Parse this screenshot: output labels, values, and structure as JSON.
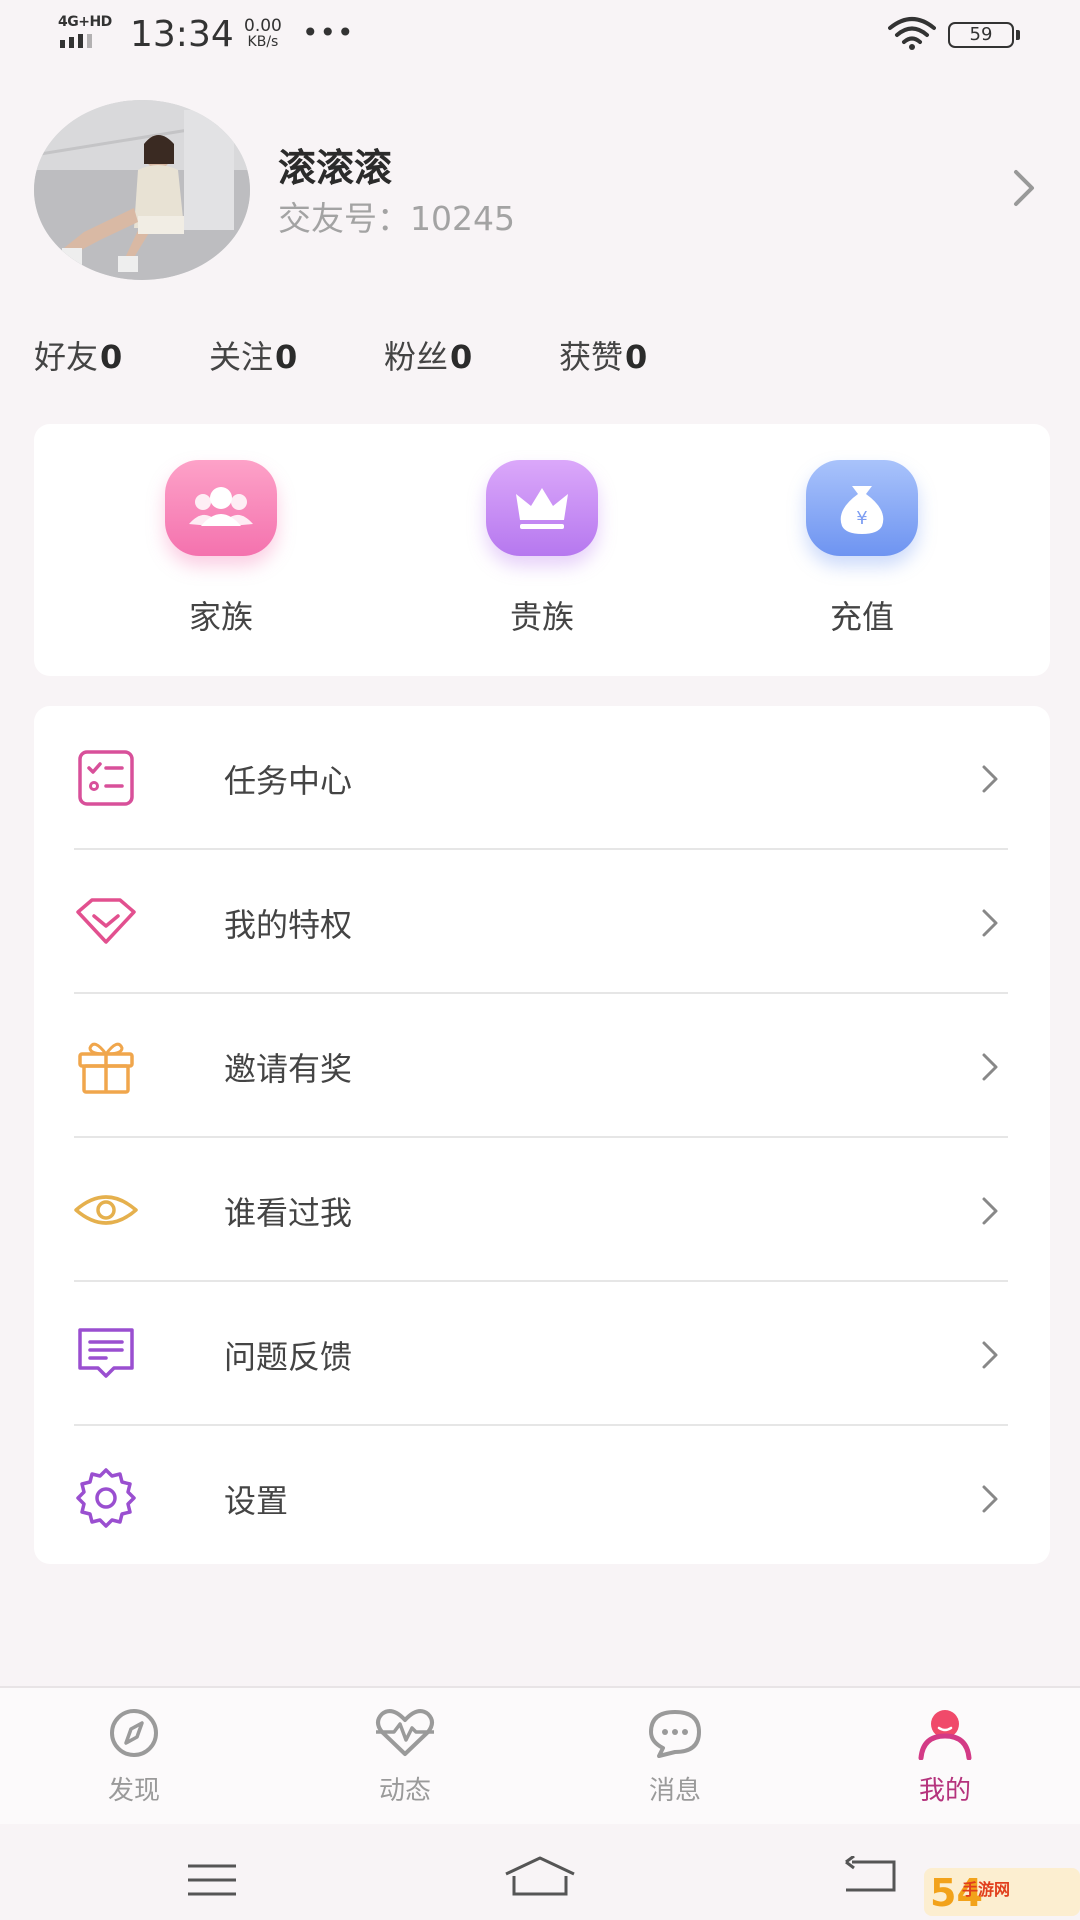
{
  "status_bar": {
    "network": "4G+HD",
    "time": "13:34",
    "speed_value": "0.00",
    "speed_unit": "KB/s",
    "more": "•••",
    "battery": "59"
  },
  "profile": {
    "name": "滚滚滚",
    "id_label": "交友号：",
    "id_value": "10245"
  },
  "stats": [
    {
      "label": "好友",
      "value": "0"
    },
    {
      "label": "关注",
      "value": "0"
    },
    {
      "label": "粉丝",
      "value": "0"
    },
    {
      "label": "获赞",
      "value": "0"
    }
  ],
  "quick_actions": [
    {
      "label": "家族",
      "icon": "family-group-icon",
      "color": "#f77fb3"
    },
    {
      "label": "贵族",
      "icon": "crown-icon",
      "color": "#c78af3"
    },
    {
      "label": "充值",
      "icon": "money-bag-icon",
      "color": "#7fa6f5"
    }
  ],
  "menu": [
    {
      "label": "任务中心",
      "icon": "task-list-icon",
      "color": "#d8509a"
    },
    {
      "label": "我的特权",
      "icon": "diamond-icon",
      "color": "#e2508f"
    },
    {
      "label": "邀请有奖",
      "icon": "gift-icon",
      "color": "#f0a64c"
    },
    {
      "label": "谁看过我",
      "icon": "eye-icon",
      "color": "#e5b04d"
    },
    {
      "label": "问题反馈",
      "icon": "feedback-icon",
      "color": "#9a4fd0"
    },
    {
      "label": "设置",
      "icon": "gear-icon",
      "color": "#9a4fd0"
    }
  ],
  "tabs": [
    {
      "label": "发现",
      "icon": "compass-icon"
    },
    {
      "label": "动态",
      "icon": "heartbeat-icon"
    },
    {
      "label": "消息",
      "icon": "chat-bubble-icon"
    },
    {
      "label": "我的",
      "icon": "person-icon",
      "active": true
    }
  ],
  "colors": {
    "accent": "#b5337d",
    "background": "#f8f4f6",
    "card": "#ffffff"
  },
  "watermark": "手游网"
}
